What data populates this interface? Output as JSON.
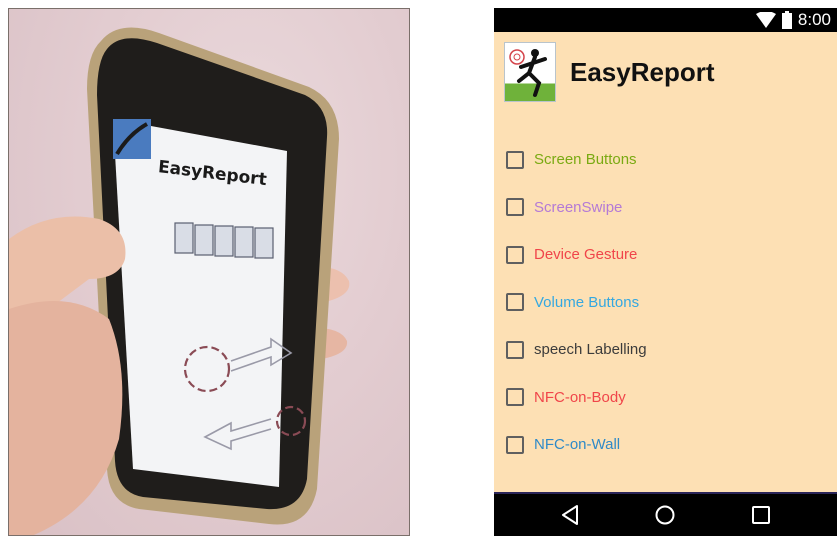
{
  "photo": {
    "app_title": "EasyReport"
  },
  "status_bar": {
    "time": "8:00",
    "icons": [
      "wifi-icon",
      "battery-icon"
    ]
  },
  "app": {
    "title": "EasyReport",
    "logo_icon": "runner-logo-icon",
    "options": [
      {
        "label": "Screen Buttons",
        "color": "#7aaa12",
        "checked": false
      },
      {
        "label": "ScreenSwipe",
        "color": "#b47ad6",
        "checked": false
      },
      {
        "label": "Device Gesture",
        "color": "#f0454a",
        "checked": false
      },
      {
        "label": "Volume Buttons",
        "color": "#35a8e0",
        "checked": false
      },
      {
        "label": "speech Labelling",
        "color": "#3c3c3c",
        "checked": false
      },
      {
        "label": "NFC-on-Body",
        "color": "#f0454a",
        "checked": false
      },
      {
        "label": "NFC-on-Wall",
        "color": "#2f8ac8",
        "checked": false
      }
    ]
  },
  "nav_bar": {
    "buttons": [
      "back-icon",
      "home-icon",
      "recents-icon"
    ]
  },
  "colors": {
    "app_background": "#fde0b4",
    "bar_background": "#000000"
  }
}
